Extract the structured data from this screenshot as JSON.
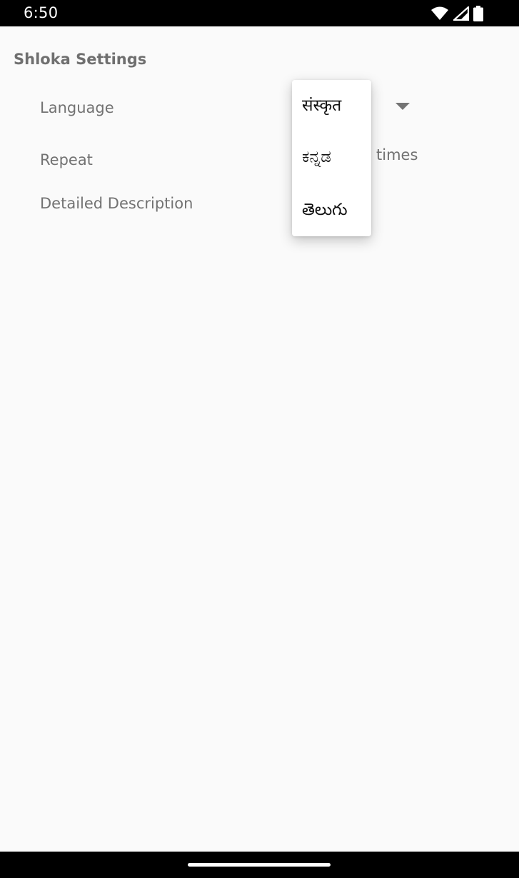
{
  "status_bar": {
    "time": "6:50",
    "icons": [
      "wifi-icon",
      "signal-icon",
      "battery-icon"
    ]
  },
  "settings": {
    "section_title": "Shloka Settings",
    "language_label": "Language",
    "repeat_label": "Repeat",
    "repeat_suffix": "times",
    "description_label": "Detailed Description"
  },
  "language_menu": {
    "options": [
      "संस्कृत",
      "ಕನ್ನಡ",
      "తెలుగు"
    ]
  },
  "colors": {
    "background": "#fafafa",
    "label_text": "#727272",
    "section_title": "#6f6f6f",
    "system_bars": "#000000",
    "menu_background": "#ffffff"
  }
}
